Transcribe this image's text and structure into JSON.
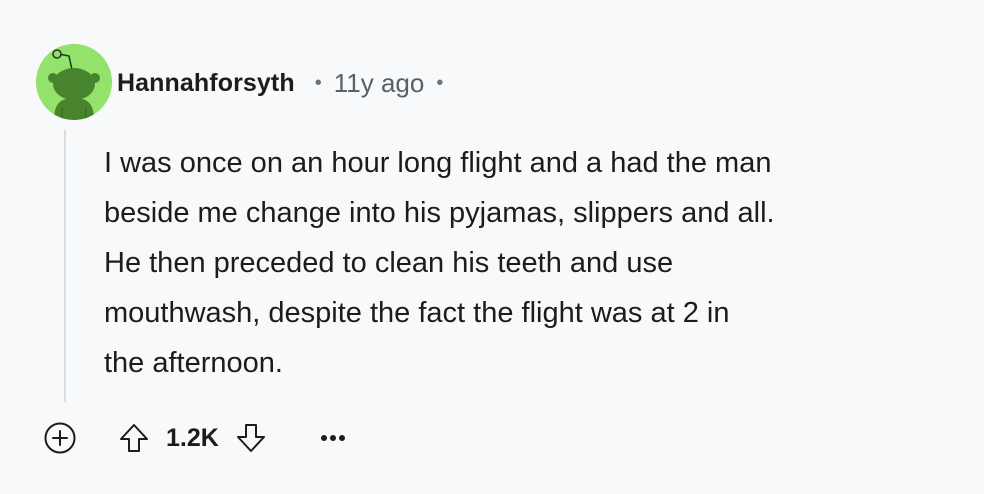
{
  "comment": {
    "username": "Hannahforsyth",
    "separator": "•",
    "timestamp": "11y ago",
    "avatar_icon": "reddit-snoo-icon",
    "avatar_bg": "#93e26b",
    "body_lines": [
      "I was once on an hour long flight and a had the man",
      "beside me change into his pyjamas, slippers and all.",
      "He then preceded to clean his teeth and use",
      "mouthwash, despite the fact the flight was at 2 in",
      "the afternoon."
    ]
  },
  "actions": {
    "expand_icon": "plus-circle-icon",
    "upvote_icon": "arrow-up-icon",
    "score": "1.2K",
    "downvote_icon": "arrow-down-icon",
    "more_icon": "ellipsis-icon"
  }
}
